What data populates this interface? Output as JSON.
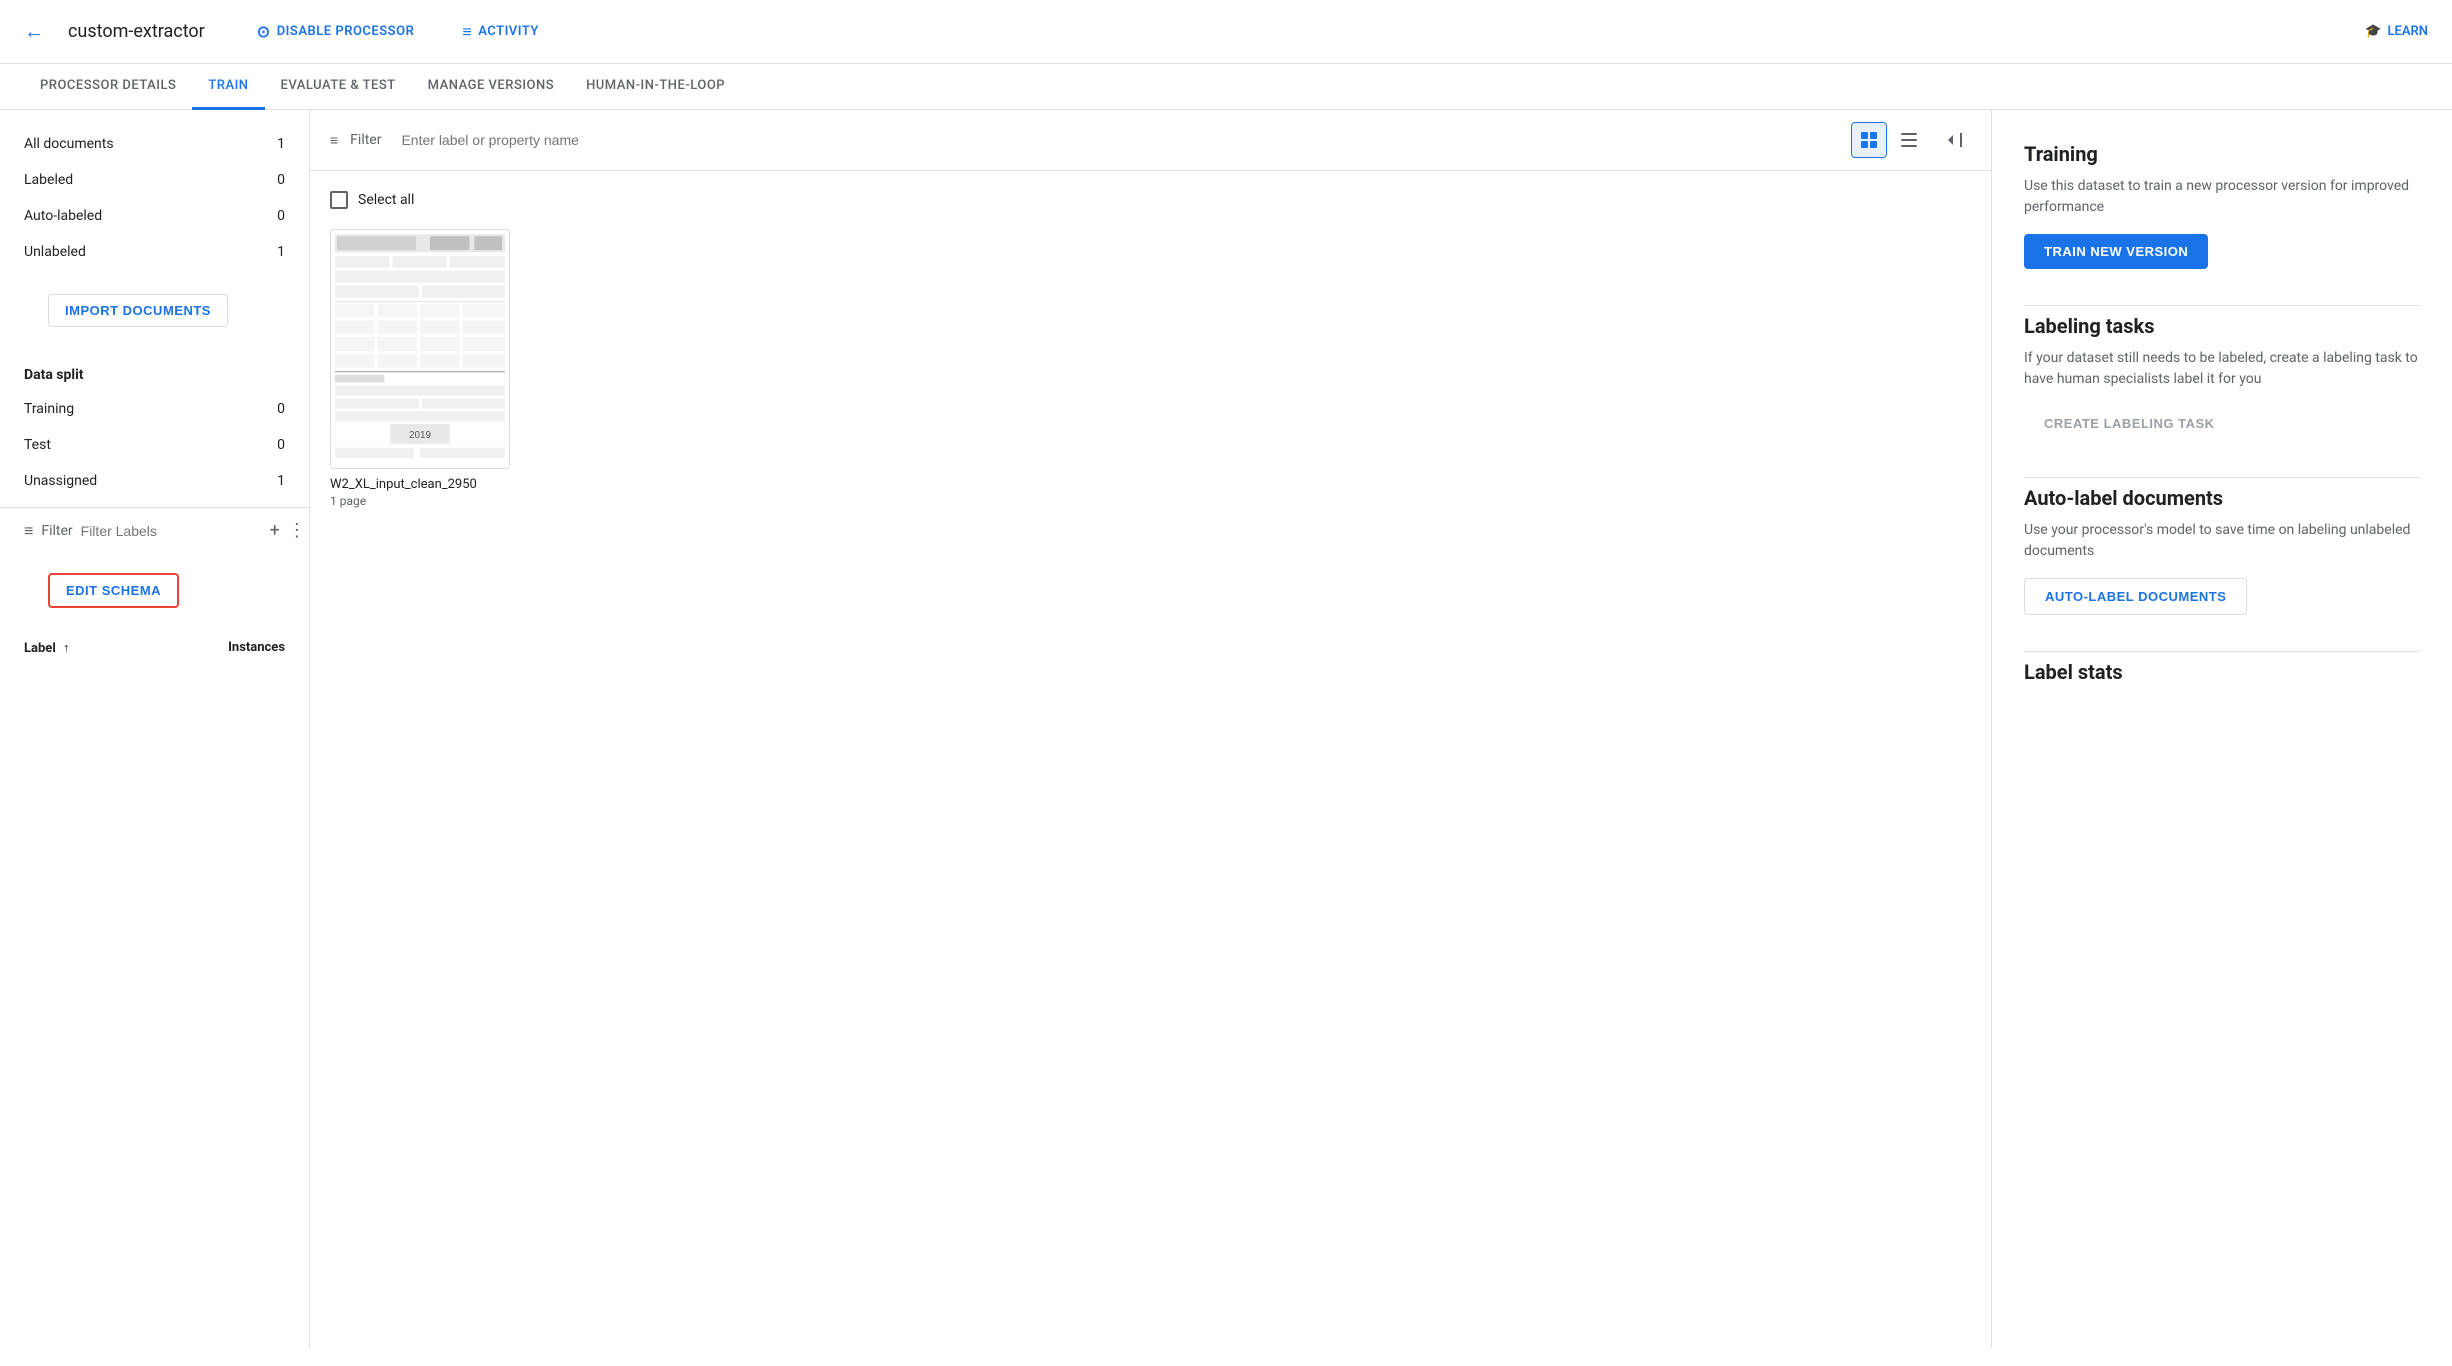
{
  "header": {
    "back_label": "←",
    "title": "custom-extractor",
    "disable_processor_label": "DISABLE PROCESSOR",
    "activity_label": "ACTIVITY",
    "learn_label": "LEARN"
  },
  "tabs": [
    {
      "id": "processor-details",
      "label": "PROCESSOR DETAILS",
      "active": false
    },
    {
      "id": "train",
      "label": "TRAIN",
      "active": true
    },
    {
      "id": "evaluate-test",
      "label": "EVALUATE & TEST",
      "active": false
    },
    {
      "id": "manage-versions",
      "label": "MANAGE VERSIONS",
      "active": false
    },
    {
      "id": "human-in-the-loop",
      "label": "HUMAN-IN-THE-LOOP",
      "active": false
    }
  ],
  "sidebar": {
    "document_counts": [
      {
        "label": "All documents",
        "count": "1"
      },
      {
        "label": "Labeled",
        "count": "0"
      },
      {
        "label": "Auto-labeled",
        "count": "0"
      },
      {
        "label": "Unlabeled",
        "count": "1"
      }
    ],
    "import_btn_label": "IMPORT DOCUMENTS",
    "data_split_title": "Data split",
    "data_split_items": [
      {
        "label": "Training",
        "count": "0"
      },
      {
        "label": "Test",
        "count": "0"
      },
      {
        "label": "Unassigned",
        "count": "1"
      }
    ],
    "filter_label": "Filter",
    "filter_placeholder": "Filter Labels",
    "edit_schema_label": "EDIT SCHEMA",
    "schema_col_label": "Label",
    "schema_col_sort": "↑",
    "schema_col_instances": "Instances"
  },
  "content": {
    "filter_label": "Filter",
    "filter_placeholder": "Enter label or property name",
    "select_all_label": "Select all",
    "document": {
      "name": "W2_XL_input_clean_2950",
      "pages": "1 page"
    }
  },
  "right_panel": {
    "training": {
      "title": "Training",
      "description": "Use this dataset to train a new processor version for improved performance",
      "btn_label": "TRAIN NEW VERSION"
    },
    "labeling_tasks": {
      "title": "Labeling tasks",
      "description": "If your dataset still needs to be labeled, create a labeling task to have human specialists label it for you",
      "btn_label": "CREATE LABELING TASK"
    },
    "auto_label": {
      "title": "Auto-label documents",
      "description": "Use your processor's model to save time on labeling unlabeled documents",
      "btn_label": "AUTO-LABEL DOCUMENTS"
    },
    "label_stats": {
      "title": "Label stats"
    }
  }
}
